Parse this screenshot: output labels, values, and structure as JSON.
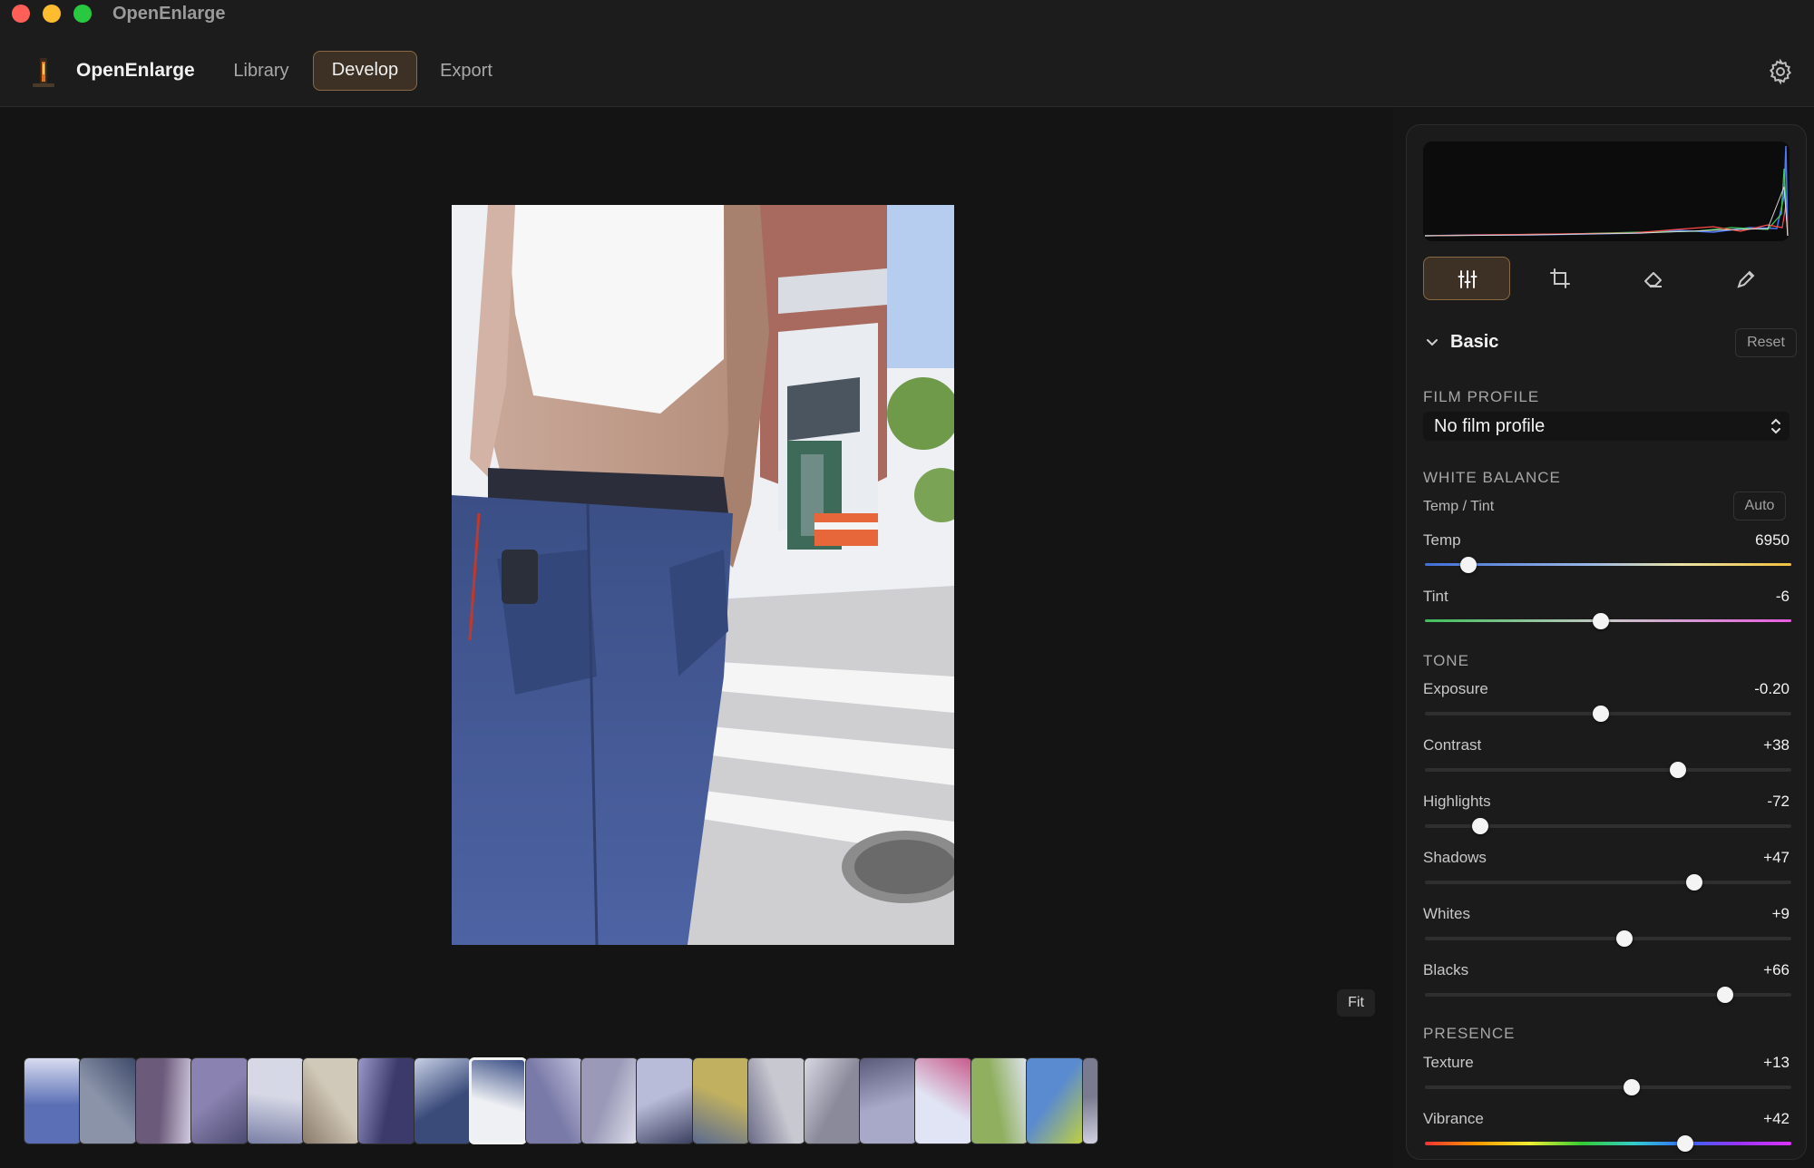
{
  "window": {
    "title": "OpenEnlarge"
  },
  "header": {
    "app_name": "OpenEnlarge",
    "tabs": [
      {
        "label": "Library",
        "active": false
      },
      {
        "label": "Develop",
        "active": true
      },
      {
        "label": "Export",
        "active": false
      }
    ],
    "settings_icon": "gear-icon"
  },
  "canvas": {
    "fit_label": "Fit",
    "filmstrip_count": 20,
    "selected_index": 8
  },
  "panel": {
    "tools": [
      "sliders-icon",
      "crop-icon",
      "eraser-icon",
      "eyedropper-icon"
    ],
    "section_title": "Basic",
    "reset_label": "Reset",
    "film_profile": {
      "label": "FILM PROFILE",
      "value": "No film profile"
    },
    "white_balance": {
      "label": "WHITE BALANCE",
      "subtitle": "Temp / Tint",
      "auto_label": "Auto",
      "temp": {
        "label": "Temp",
        "value": "6950",
        "level": 0.12
      },
      "tint": {
        "label": "Tint",
        "value": "-6",
        "level": 0.48
      }
    },
    "tone": {
      "label": "TONE",
      "sliders": [
        {
          "label": "Exposure",
          "value": "-0.20",
          "level": 0.48
        },
        {
          "label": "Contrast",
          "value": "+38",
          "level": 0.69
        },
        {
          "label": "Highlights",
          "value": "-72",
          "level": 0.15
        },
        {
          "label": "Shadows",
          "value": "+47",
          "level": 0.735
        },
        {
          "label": "Whites",
          "value": "+9",
          "level": 0.545
        },
        {
          "label": "Blacks",
          "value": "+66",
          "level": 0.82
        }
      ]
    },
    "presence": {
      "label": "PRESENCE",
      "texture": {
        "label": "Texture",
        "value": "+13",
        "level": 0.565
      },
      "vibrance": {
        "label": "Vibrance",
        "value": "+42",
        "level": 0.71
      }
    }
  },
  "colors": {
    "accent_fill": "#3d3125",
    "accent_border": "#8a6a45",
    "background": "#161616"
  }
}
